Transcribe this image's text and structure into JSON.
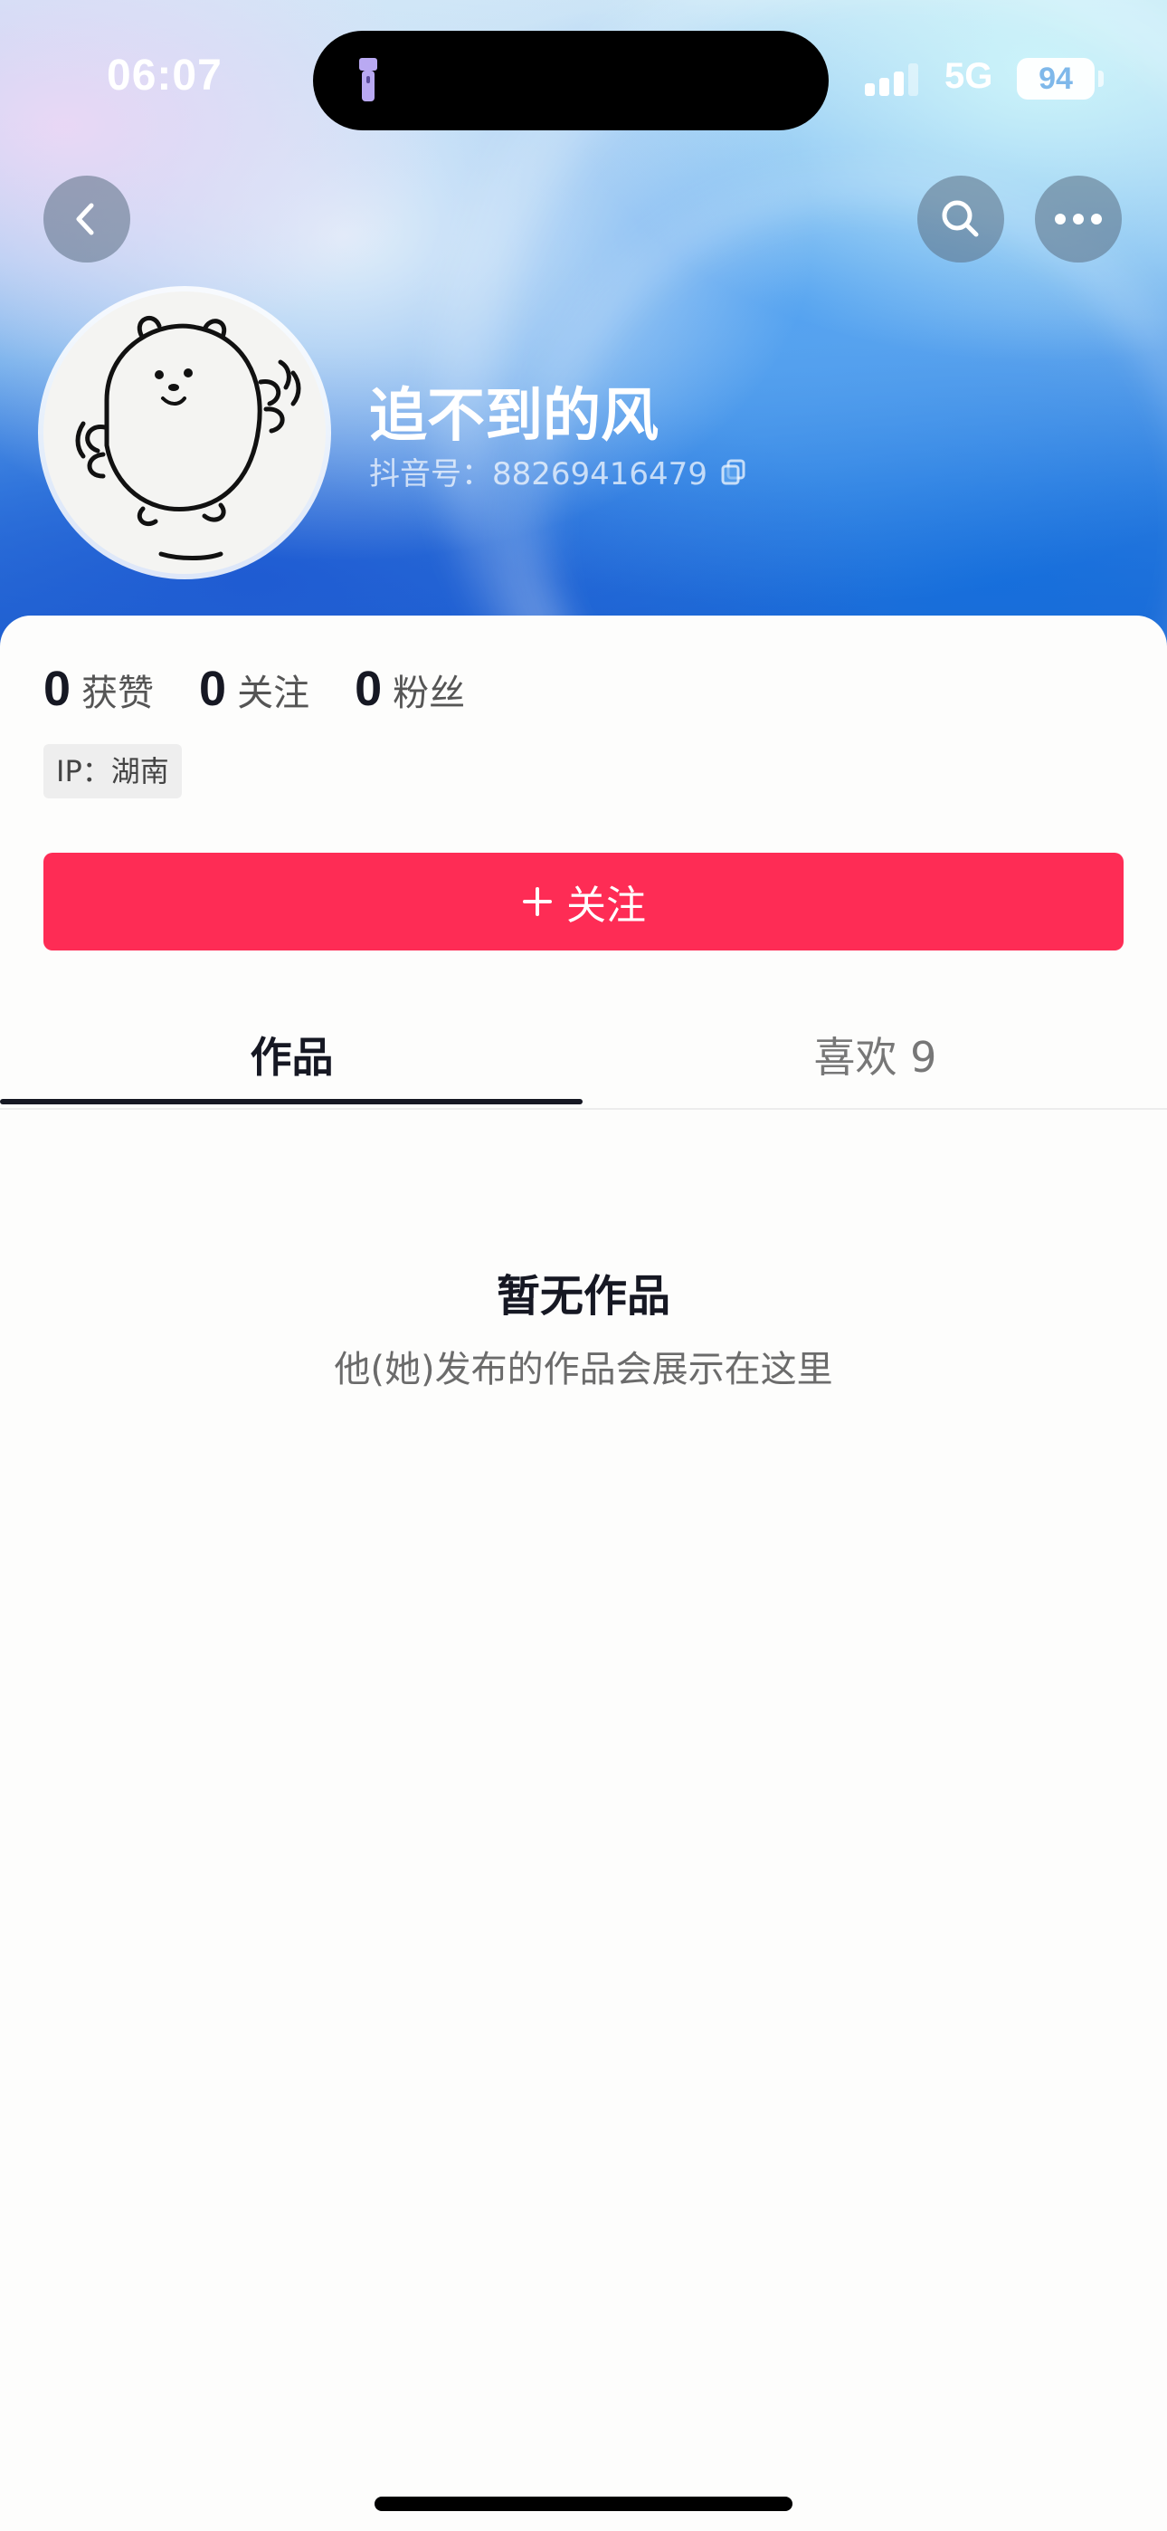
{
  "status_bar": {
    "time": "06:07",
    "network": "5G",
    "battery": "94"
  },
  "header": {
    "back_icon": "chevron-left-icon",
    "search_icon": "search-icon",
    "more_icon": "more-dots-icon"
  },
  "profile": {
    "name": "追不到的风",
    "douyin_id": "抖音号：88269416479",
    "avatar": "cartoon-bear-avatar"
  },
  "stats": [
    {
      "count": "0",
      "label": "获赞"
    },
    {
      "count": "0",
      "label": "关注"
    },
    {
      "count": "0",
      "label": "粉丝"
    }
  ],
  "ip_location": "IP：湖南",
  "follow_button": {
    "label": "关注",
    "color": "#fe2c55"
  },
  "tabs": [
    {
      "label": "作品",
      "active": true
    },
    {
      "label": "喜欢 9",
      "active": false
    }
  ],
  "empty_state": {
    "title": "暂无作品",
    "subtitle": "他(她)发布的作品会展示在这里"
  }
}
